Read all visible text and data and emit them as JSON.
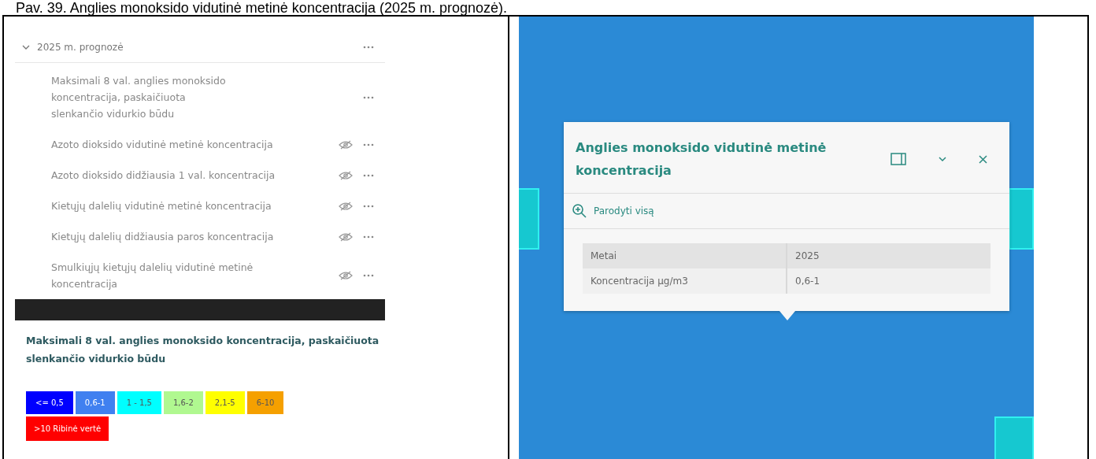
{
  "caption": "Pav. 39. Anglies monoksido vidutinė metinė koncentracija (2025 m. prognozė).",
  "layer_group": {
    "title": "2025 m. prognozė",
    "expanded": true,
    "layers": [
      {
        "name": "Maksimali 8 val. anglies monoksido koncentracija, paskaičiuota slenkančio vidurkio būdu",
        "hidden": false
      },
      {
        "name": "Azoto dioksido vidutinė metinė koncentracija",
        "hidden": true
      },
      {
        "name": "Azoto dioksido didžiausia 1 val. koncentracija",
        "hidden": true
      },
      {
        "name": "Kietųjų dalelių vidutinė metinė koncentracija",
        "hidden": true
      },
      {
        "name": "Kietųjų dalelių didžiausia paros koncentracija",
        "hidden": true
      },
      {
        "name": "Smulkiųjų kietųjų dalelių vidutinė metinė koncentracija",
        "hidden": true
      }
    ]
  },
  "legend": {
    "title": "Maksimali 8 val. anglies monoksido koncentracija, paskaičiuota slenkančio vidurkio būdu",
    "classes": [
      {
        "label": "<= 0,5",
        "color": "#0000ff"
      },
      {
        "label": "0,6-1",
        "color": "#4080f0"
      },
      {
        "label": "1 - 1,5",
        "color": "#00ffff"
      },
      {
        "label": "1,6-2",
        "color": "#b0f890"
      },
      {
        "label": "2,1-5",
        "color": "#ffff00"
      },
      {
        "label": "6-10",
        "color": "#f5a000"
      },
      {
        "label": ">10 Ribinė vertė",
        "color": "#ff0000"
      }
    ]
  },
  "popup": {
    "title": "Anglies monoksido vidutinė metinė koncentracija",
    "zoom_link": "Parodyti visą",
    "rows": [
      {
        "field": "Metai",
        "value": "2025"
      },
      {
        "field": "Koncentracija µg/m3",
        "value": "0,6-1"
      }
    ]
  }
}
